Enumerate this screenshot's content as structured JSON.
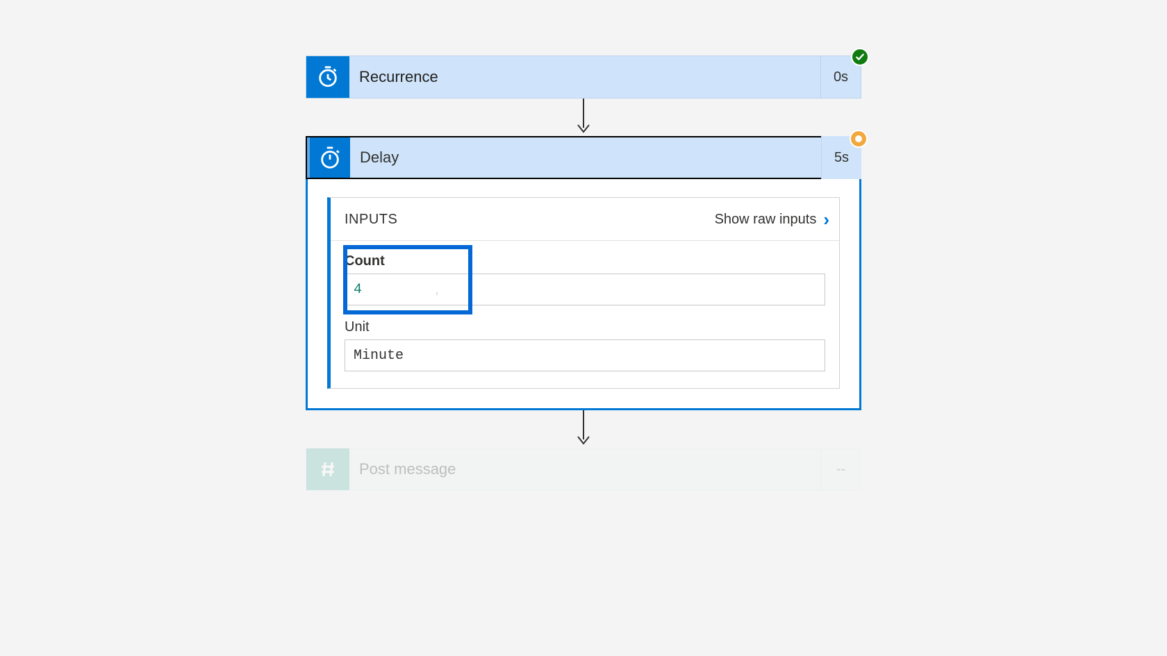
{
  "steps": {
    "recurrence": {
      "label": "Recurrence",
      "duration": "0s",
      "status": "success"
    },
    "delay": {
      "label": "Delay",
      "duration": "5s",
      "status": "running"
    },
    "post": {
      "label": "Post message",
      "duration": "--",
      "status": "pending"
    }
  },
  "delay_panel": {
    "section_label": "INPUTS",
    "raw_link": "Show raw inputs",
    "fields": {
      "count": {
        "label": "Count",
        "value": "4"
      },
      "unit": {
        "label": "Unit",
        "value": "Minute"
      }
    }
  },
  "colors": {
    "primary": "#0078d4",
    "header_fill": "#cfe4fa",
    "success": "#107c10",
    "running": "#f2a83b",
    "highlight": "#0468d7"
  }
}
